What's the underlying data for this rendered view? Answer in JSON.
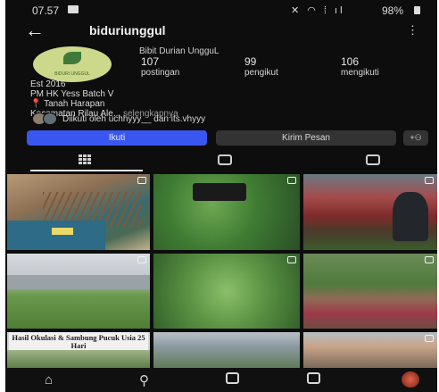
{
  "status_bar": {
    "time": "07.57",
    "battery": "98%"
  },
  "header": {
    "username": "biduriunggul"
  },
  "profile": {
    "avatar_text": "BIDURI UNGGUL",
    "full_name": "Bibit Durian UngguL",
    "stats": [
      {
        "value": "107",
        "label": "postingan"
      },
      {
        "value": "99",
        "label": "pengikut"
      },
      {
        "value": "106",
        "label": "mengikuti"
      }
    ],
    "bio_lines": [
      "Est 2016",
      "PM HK Yess Batch V",
      "Tanah Harapan",
      "Kecamatan Rilau Ale..."
    ],
    "bio_more": "selengkapnya",
    "followed_by": "Diikuti oleh uchhyyy__ dan its.vhyyy"
  },
  "buttons": {
    "follow": "Ikuti",
    "message": "Kirim Pesan",
    "suggest": "+⚇"
  },
  "tabs": [
    {
      "name": "posts-grid",
      "icon": "grid-icon"
    },
    {
      "name": "reels",
      "icon": "reels-icon"
    },
    {
      "name": "tagged",
      "icon": "tagged-icon"
    }
  ],
  "posts": {
    "caption_p7": "Hasil Okulasi & Sambung Pucuk Usia 25 Hari"
  },
  "nav": [
    "home-icon",
    "search-icon",
    "create-icon",
    "reels-icon",
    "profile-avatar"
  ]
}
